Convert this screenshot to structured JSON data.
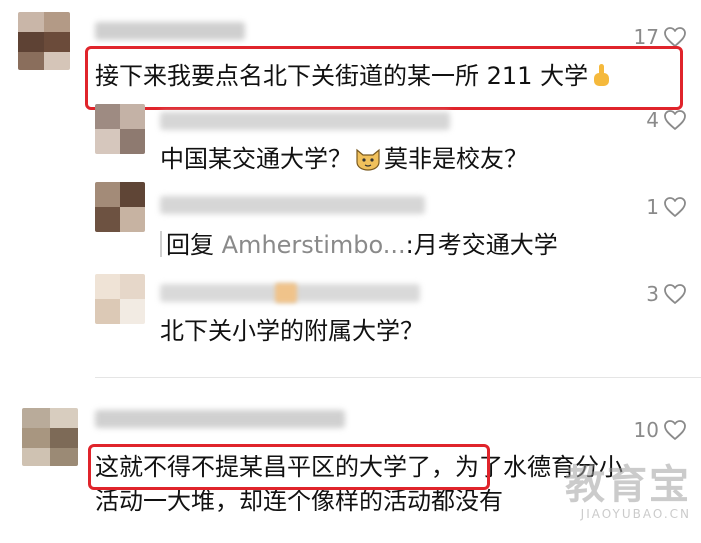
{
  "comments": [
    {
      "likes": "17",
      "text": "接下来我要点名北下关街道的某一所 211 大学",
      "emoji": "point-up-hand"
    },
    {
      "likes": "4",
      "text_before": "中国某交通大学？",
      "emoji": "cat-face",
      "text_after": "莫非是校友？"
    },
    {
      "likes": "1",
      "reply_prefix": "回复 ",
      "reply_name": "Amherstimbo...",
      "reply_text": ":月考交通大学"
    },
    {
      "likes": "3",
      "text": "北下关小学的附属大学？"
    },
    {
      "likes": "10",
      "line1_highlight": "这就不得不提某昌平区的大学了，",
      "line1_rest": "为了水德育分小",
      "line2": "活动一大堆，却连个像样的活动都没有"
    }
  ],
  "icons": {
    "like": "heart-outline-icon"
  },
  "watermark": {
    "main": "教育宝",
    "sub": "JIAOYUBAO.CN"
  },
  "colors": {
    "highlight": "#e0242b",
    "meta": "#8a8a8a"
  }
}
